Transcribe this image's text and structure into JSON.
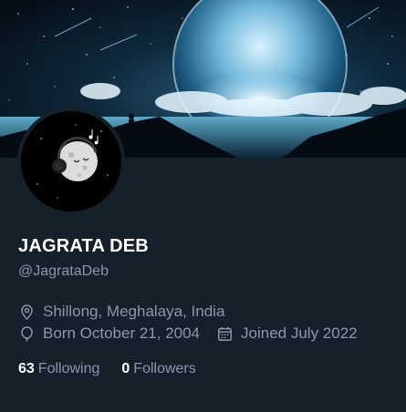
{
  "profile": {
    "name": "JAGRATA DEB",
    "handle": "@JagrataDeb",
    "location": "Shillong, Meghalaya, India",
    "born": "Born October 21, 2004",
    "joined": "Joined July 2022"
  },
  "stats": {
    "following_count": "63",
    "following_label": "Following",
    "followers_count": "0",
    "followers_label": "Followers"
  },
  "icons": {
    "location": "location-pin-icon",
    "born": "balloon-icon",
    "joined": "calendar-icon"
  },
  "colors": {
    "background": "#15202b",
    "text_primary": "#ffffff",
    "text_secondary": "#8b98a5"
  }
}
